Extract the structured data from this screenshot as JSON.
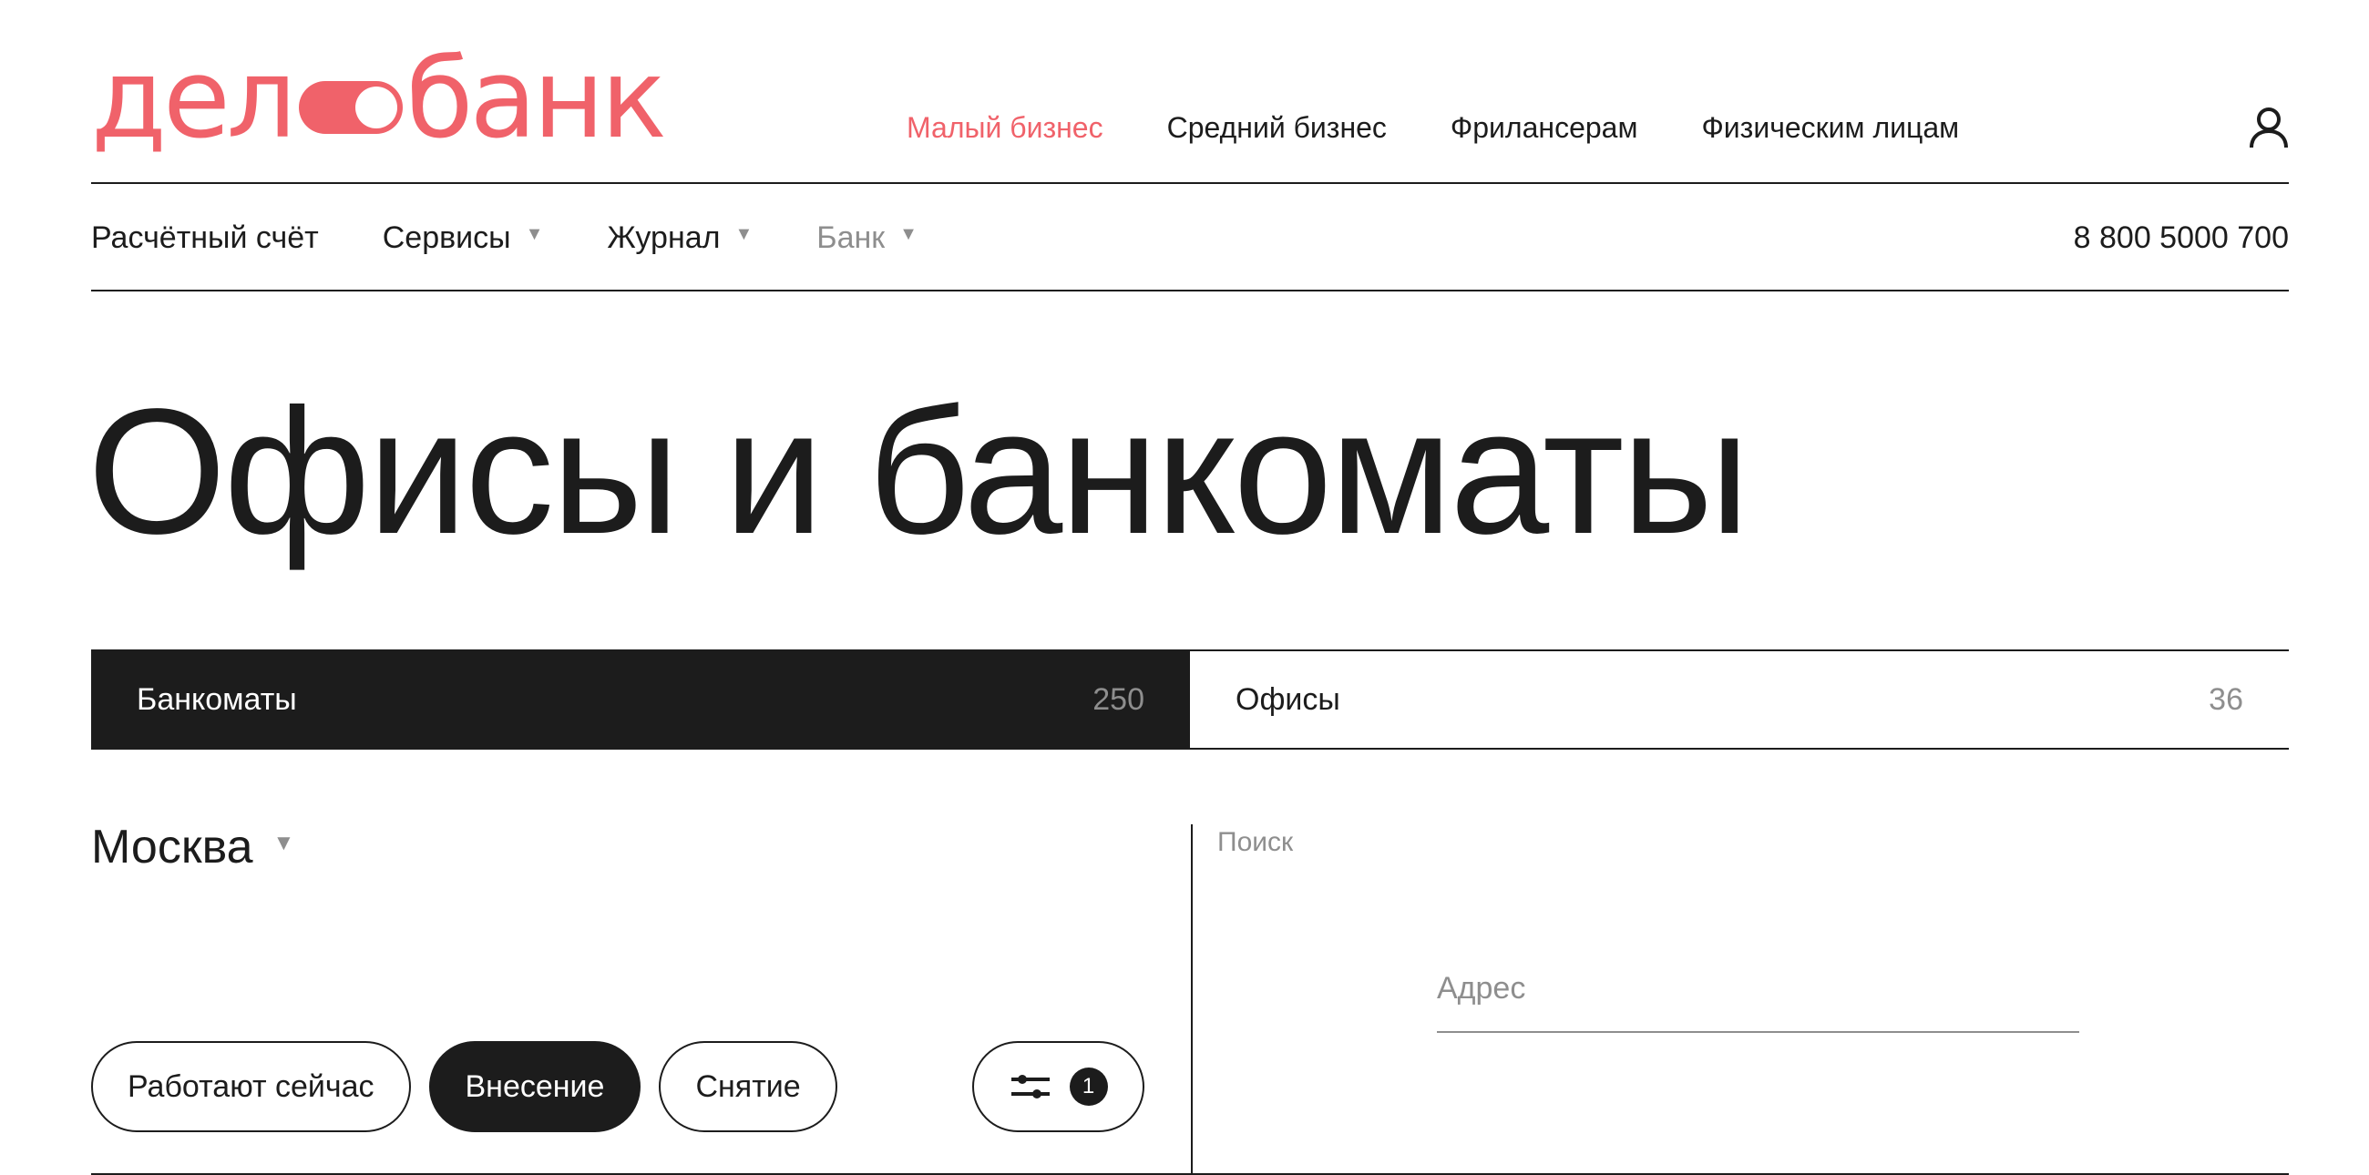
{
  "brand": {
    "logo_left": "дел",
    "logo_right": "банк",
    "accent_color": "#f0626a"
  },
  "top_nav": [
    {
      "label": "Малый бизнес",
      "active": true
    },
    {
      "label": "Средний бизнес",
      "active": false
    },
    {
      "label": "Фрилансерам",
      "active": false
    },
    {
      "label": "Физическим лицам",
      "active": false
    }
  ],
  "user_icon": "user-icon",
  "sub_nav": [
    {
      "label": "Расчётный счёт",
      "dropdown": false
    },
    {
      "label": "Сервисы",
      "dropdown": true
    },
    {
      "label": "Журнал",
      "dropdown": true
    },
    {
      "label": "Банк",
      "dropdown": true,
      "muted": true
    }
  ],
  "caret_glyph": "▼",
  "phone": "8 800 5000 700",
  "page_title": "Офисы и банкоматы",
  "tabs": [
    {
      "label": "Банкоматы",
      "count": "250",
      "active": true
    },
    {
      "label": "Офисы",
      "count": "36",
      "active": false
    }
  ],
  "city": {
    "label": "Москва"
  },
  "search": {
    "label": "Поиск",
    "address_placeholder": "Адрес"
  },
  "filters": [
    {
      "label": "Работают сейчас",
      "active": false
    },
    {
      "label": "Внесение",
      "active": true
    },
    {
      "label": "Снятие",
      "active": false
    }
  ],
  "filter_button": {
    "icon": "sliders-icon",
    "badge": "1"
  }
}
